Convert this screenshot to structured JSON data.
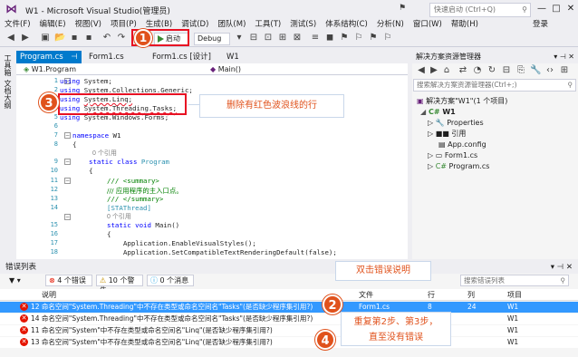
{
  "window": {
    "title": "W1 - Microsoft Visual Studio(管理员)",
    "quick_launch_placeholder": "快速启动 (Ctrl+Q)"
  },
  "menu": [
    "文件(F)",
    "编辑(E)",
    "视图(V)",
    "项目(P)",
    "生成(B)",
    "调试(D)",
    "团队(M)",
    "工具(T)",
    "测试(S)",
    "体系结构(C)",
    "分析(N)",
    "窗口(W)",
    "帮助(H)"
  ],
  "login": "登录",
  "toolbar": {
    "start_label": "启动",
    "config": "Debug"
  },
  "left_strip": [
    "工具箱",
    "文档大纲"
  ],
  "editor": {
    "tabs": [
      "Program.cs",
      "Form1.cs",
      "Form1.cs [设计]",
      "W1"
    ],
    "nav_class": "W1.Program",
    "nav_member": "Main()"
  },
  "code_lines": [
    {
      "n": "1",
      "t": "using System;"
    },
    {
      "n": "2",
      "t": "using System.Collections.Generic;"
    },
    {
      "n": "3",
      "t": "using System.Linq;"
    },
    {
      "n": "4",
      "t": "using System.Threading.Tasks;"
    },
    {
      "n": "5",
      "t": "using System.Windows.Forms;"
    },
    {
      "n": "6",
      "t": ""
    },
    {
      "n": "7",
      "t": "namespace W1"
    },
    {
      "n": "8",
      "t": "{"
    },
    {
      "n": "",
      "t": "0 个引用"
    },
    {
      "n": "9",
      "t": "static class Program"
    },
    {
      "n": "10",
      "t": "{"
    },
    {
      "n": "11",
      "t": "/// <summary>"
    },
    {
      "n": "12",
      "t": "/// 应用程序的主入口点。"
    },
    {
      "n": "13",
      "t": "/// </summary>"
    },
    {
      "n": "14",
      "t": "[STAThread]"
    },
    {
      "n": "",
      "t": "0 个引用"
    },
    {
      "n": "15",
      "t": "static void Main()"
    },
    {
      "n": "16",
      "t": "{"
    },
    {
      "n": "17",
      "t": "Application.EnableVisualStyles();"
    },
    {
      "n": "18",
      "t": "Application.SetCompatibleTextRenderingDefault(false);"
    }
  ],
  "callouts": {
    "step1": "1",
    "step2": "2",
    "step3": "3",
    "step4": "4",
    "delete_lines": "删除有红色波浪线的行",
    "double_click": "双击错误说明",
    "repeat": "重复第2步、第3步，\n直至没有错误"
  },
  "solution_explorer": {
    "title": "解决方案资源管理器",
    "search_placeholder": "搜索解决方案资源管理器(Ctrl+;)",
    "nodes": [
      "解决方案\"W1\"(1 个项目)",
      "W1",
      "Properties",
      "引用",
      "App.config",
      "Form1.cs",
      "Program.cs"
    ]
  },
  "error_list": {
    "title": "错误列表",
    "errors_btn": "4 个错误",
    "warnings_btn": "10 个警告",
    "messages_btn": "0 个消息",
    "search_placeholder": "搜索错误列表",
    "columns": [
      "说明",
      "文件",
      "行",
      "列",
      "项目"
    ],
    "rows": [
      {
        "desc": "12 命名空间\"System.Threading\"中不存在类型或命名空间名\"Tasks\"(是否缺少程序集引用?)",
        "file": "Form1.cs",
        "line": "8",
        "col": "24",
        "project": "W1"
      },
      {
        "desc": "14 命名空间\"System.Threading\"中不存在类型或命名空间名\"Tasks\"(是否缺少程序集引用?)",
        "file": "",
        "line": "",
        "col": "",
        "project": "W1"
      },
      {
        "desc": "11 命名空间\"System\"中不存在类型或命名空间名\"Linq\"(是否缺少程序集引用?)",
        "file": "",
        "line": "",
        "col": "",
        "project": "W1"
      },
      {
        "desc": "13 命名空间\"System\"中不存在类型或命名空间名\"Linq\"(是否缺少程序集引用?)",
        "file": "",
        "line": "",
        "col": "",
        "project": "W1"
      }
    ]
  },
  "colors": {
    "accent": "#007ACC",
    "annotation": "#E0521C",
    "error_red": "#E51400",
    "selection": "#3399FF"
  }
}
